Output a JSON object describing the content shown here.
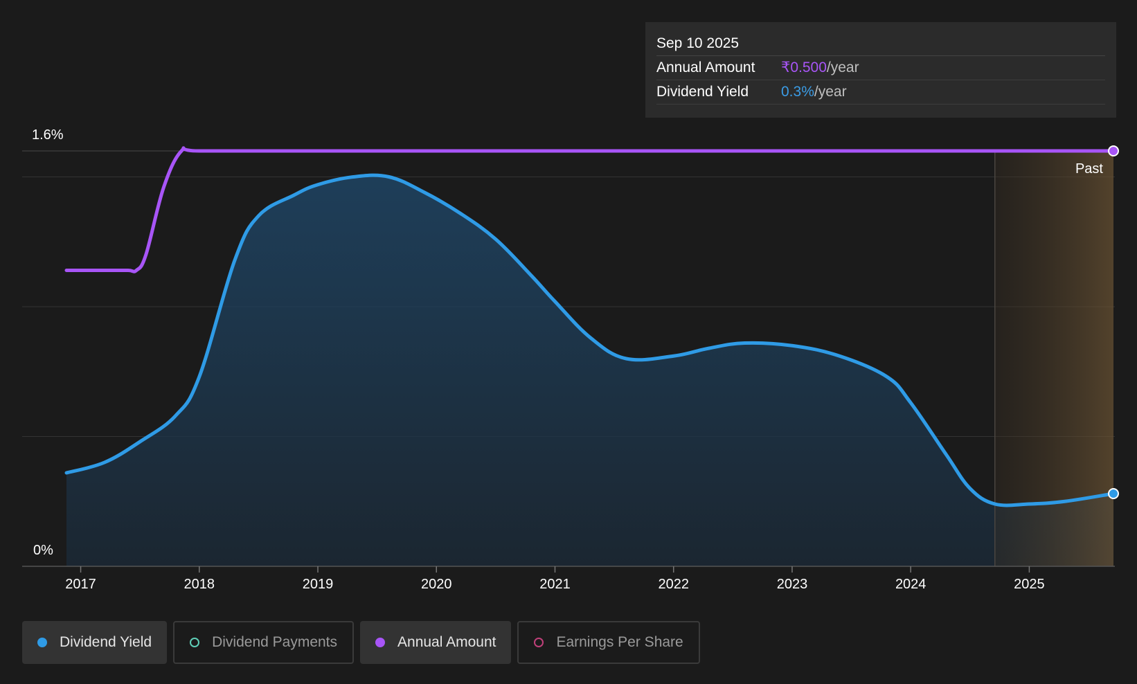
{
  "colors": {
    "yield": "#2f9be6",
    "annual": "#a855f7",
    "payments": "#5fcfb8",
    "eps": "#c0407a",
    "background": "#1b1b1b"
  },
  "tooltip": {
    "date": "Sep 10 2025",
    "annual_label": "Annual Amount",
    "annual_value": "₹0.500",
    "annual_unit": "/year",
    "yield_label": "Dividend Yield",
    "yield_value": "0.3%",
    "yield_unit": "/year"
  },
  "legend": [
    {
      "label": "Dividend Yield",
      "active": true,
      "color": "#2f9be6"
    },
    {
      "label": "Dividend Payments",
      "active": false,
      "color": "#5fcfb8"
    },
    {
      "label": "Annual Amount",
      "active": true,
      "color": "#a855f7"
    },
    {
      "label": "Earnings Per Share",
      "active": false,
      "color": "#c0407a"
    }
  ],
  "chart_data": {
    "type": "area",
    "y_tick_labels": [
      "1.6%",
      "0%"
    ],
    "ylim": [
      0,
      1.6
    ],
    "x_tick_labels": [
      "2017",
      "2018",
      "2019",
      "2020",
      "2021",
      "2022",
      "2023",
      "2024",
      "2025"
    ],
    "xlim": [
      2016.88,
      2025.71
    ],
    "past_label": "Past",
    "past_start": 2024.71,
    "grid": true,
    "series": [
      {
        "name": "Dividend Yield",
        "x": [
          2016.88,
          2017.2,
          2017.5,
          2017.8,
          2018.0,
          2018.3,
          2018.5,
          2018.8,
          2019.0,
          2019.3,
          2019.6,
          2019.9,
          2020.2,
          2020.5,
          2020.8,
          2021.0,
          2021.3,
          2021.6,
          2022.0,
          2022.3,
          2022.6,
          2023.0,
          2023.4,
          2023.8,
          2024.0,
          2024.3,
          2024.5,
          2024.71,
          2025.0,
          2025.3,
          2025.71
        ],
        "y": [
          0.36,
          0.4,
          0.48,
          0.58,
          0.73,
          1.18,
          1.35,
          1.43,
          1.47,
          1.5,
          1.5,
          1.44,
          1.36,
          1.26,
          1.12,
          1.02,
          0.88,
          0.8,
          0.81,
          0.84,
          0.86,
          0.85,
          0.81,
          0.73,
          0.63,
          0.43,
          0.3,
          0.24,
          0.24,
          0.25,
          0.28
        ]
      },
      {
        "name": "Annual Amount",
        "x": [
          2016.88,
          2017.0,
          2017.2,
          2017.4,
          2017.47,
          2017.55,
          2017.7,
          2017.85,
          2018.0,
          2019.0,
          2020.0,
          2021.0,
          2022.0,
          2023.0,
          2024.0,
          2025.0,
          2025.71
        ],
        "y": [
          1.14,
          1.14,
          1.14,
          1.14,
          1.14,
          1.2,
          1.46,
          1.6,
          1.6,
          1.6,
          1.6,
          1.6,
          1.6,
          1.6,
          1.6,
          1.6,
          1.6
        ]
      }
    ]
  }
}
